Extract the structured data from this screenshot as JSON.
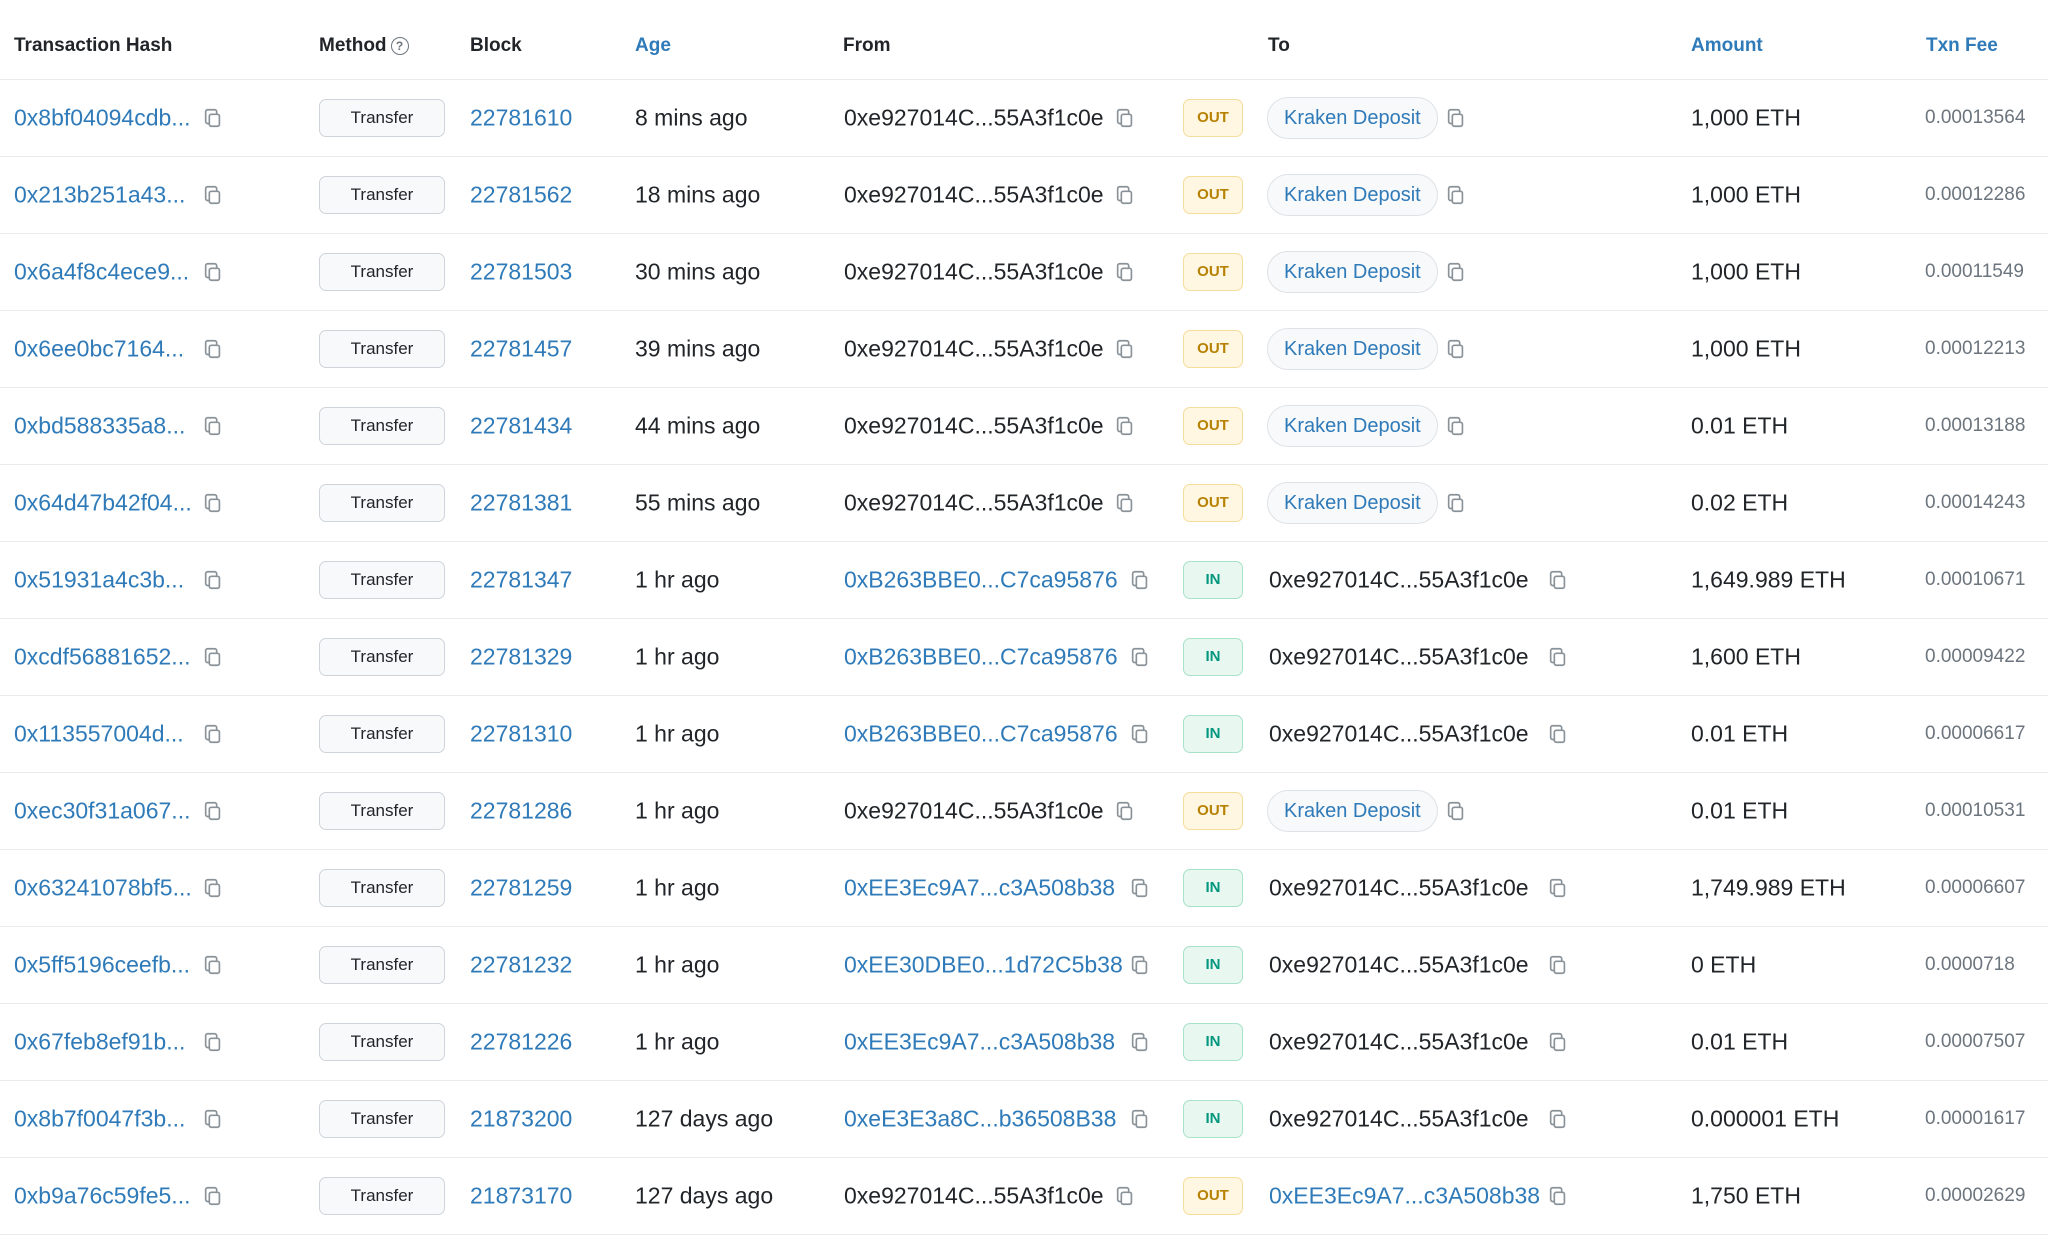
{
  "headers": {
    "tx_hash": "Transaction Hash",
    "method": "Method",
    "block": "Block",
    "age": "Age",
    "from": "From",
    "to": "To",
    "amount": "Amount",
    "txn_fee": "Txn Fee"
  },
  "rows": [
    {
      "hash": "0x8bf04094cdb...",
      "method": "Transfer",
      "block": "22781610",
      "age": "8 mins ago",
      "from": "0xe927014C...55A3f1c0e",
      "dir": "OUT",
      "to": "Kraken Deposit",
      "amount": "1,000 ETH",
      "fee": "0.00013564"
    },
    {
      "hash": "0x213b251a43...",
      "method": "Transfer",
      "block": "22781562",
      "age": "18 mins ago",
      "from": "0xe927014C...55A3f1c0e",
      "dir": "OUT",
      "to": "Kraken Deposit",
      "amount": "1,000 ETH",
      "fee": "0.00012286"
    },
    {
      "hash": "0x6a4f8c4ece9...",
      "method": "Transfer",
      "block": "22781503",
      "age": "30 mins ago",
      "from": "0xe927014C...55A3f1c0e",
      "dir": "OUT",
      "to": "Kraken Deposit",
      "amount": "1,000 ETH",
      "fee": "0.00011549"
    },
    {
      "hash": "0x6ee0bc7164...",
      "method": "Transfer",
      "block": "22781457",
      "age": "39 mins ago",
      "from": "0xe927014C...55A3f1c0e",
      "dir": "OUT",
      "to": "Kraken Deposit",
      "amount": "1,000 ETH",
      "fee": "0.00012213"
    },
    {
      "hash": "0xbd588335a8...",
      "method": "Transfer",
      "block": "22781434",
      "age": "44 mins ago",
      "from": "0xe927014C...55A3f1c0e",
      "dir": "OUT",
      "to": "Kraken Deposit",
      "amount": "0.01 ETH",
      "fee": "0.00013188"
    },
    {
      "hash": "0x64d47b42f04...",
      "method": "Transfer",
      "block": "22781381",
      "age": "55 mins ago",
      "from": "0xe927014C...55A3f1c0e",
      "dir": "OUT",
      "to": "Kraken Deposit",
      "amount": "0.02 ETH",
      "fee": "0.00014243"
    },
    {
      "hash": "0x51931a4c3b...",
      "method": "Transfer",
      "block": "22781347",
      "age": "1 hr ago",
      "from": "0xB263BBE0...C7ca95876",
      "dir": "IN",
      "to": "0xe927014C...55A3f1c0e",
      "amount": "1,649.989 ETH",
      "fee": "0.00010671"
    },
    {
      "hash": "0xcdf56881652...",
      "method": "Transfer",
      "block": "22781329",
      "age": "1 hr ago",
      "from": "0xB263BBE0...C7ca95876",
      "dir": "IN",
      "to": "0xe927014C...55A3f1c0e",
      "amount": "1,600 ETH",
      "fee": "0.00009422"
    },
    {
      "hash": "0x113557004d...",
      "method": "Transfer",
      "block": "22781310",
      "age": "1 hr ago",
      "from": "0xB263BBE0...C7ca95876",
      "dir": "IN",
      "to": "0xe927014C...55A3f1c0e",
      "amount": "0.01 ETH",
      "fee": "0.00006617"
    },
    {
      "hash": "0xec30f31a067...",
      "method": "Transfer",
      "block": "22781286",
      "age": "1 hr ago",
      "from": "0xe927014C...55A3f1c0e",
      "dir": "OUT",
      "to": "Kraken Deposit",
      "amount": "0.01 ETH",
      "fee": "0.00010531"
    },
    {
      "hash": "0x63241078bf5...",
      "method": "Transfer",
      "block": "22781259",
      "age": "1 hr ago",
      "from": "0xEE3Ec9A7...c3A508b38",
      "dir": "IN",
      "to": "0xe927014C...55A3f1c0e",
      "amount": "1,749.989 ETH",
      "fee": "0.00006607"
    },
    {
      "hash": "0x5ff5196ceefb...",
      "method": "Transfer",
      "block": "22781232",
      "age": "1 hr ago",
      "from": "0xEE30DBE0...1d72C5b38",
      "dir": "IN",
      "to": "0xe927014C...55A3f1c0e",
      "amount": "0 ETH",
      "fee": "0.0000718"
    },
    {
      "hash": "0x67feb8ef91b...",
      "method": "Transfer",
      "block": "22781226",
      "age": "1 hr ago",
      "from": "0xEE3Ec9A7...c3A508b38",
      "dir": "IN",
      "to": "0xe927014C...55A3f1c0e",
      "amount": "0.01 ETH",
      "fee": "0.00007507"
    },
    {
      "hash": "0x8b7f0047f3b...",
      "method": "Transfer",
      "block": "21873200",
      "age": "127 days ago",
      "from": "0xeE3E3a8C...b36508B38",
      "dir": "IN",
      "to": "0xe927014C...55A3f1c0e",
      "amount": "0.000001 ETH",
      "fee": "0.00001617"
    },
    {
      "hash": "0xb9a76c59fe5...",
      "method": "Transfer",
      "block": "21873170",
      "age": "127 days ago",
      "from": "0xe927014C...55A3f1c0e",
      "dir": "OUT",
      "to": "0xEE3Ec9A7...c3A508b38",
      "amount": "1,750 ETH",
      "fee": "0.00002629"
    }
  ]
}
